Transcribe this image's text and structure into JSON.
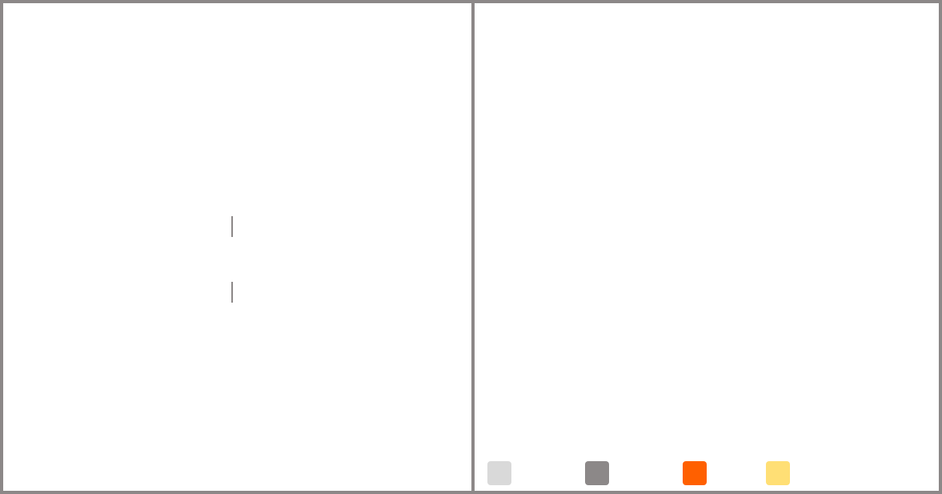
{
  "palette": {
    "swatches": [
      {
        "name": "light-gray",
        "color": "#d9d9d9"
      },
      {
        "name": "gray",
        "color": "#8c8888"
      },
      {
        "name": "orange",
        "color": "#ff6000"
      },
      {
        "name": "yellow",
        "color": "#ffdf75"
      }
    ]
  },
  "colors": {
    "border": "#8c8888",
    "background": "#ffffff"
  }
}
